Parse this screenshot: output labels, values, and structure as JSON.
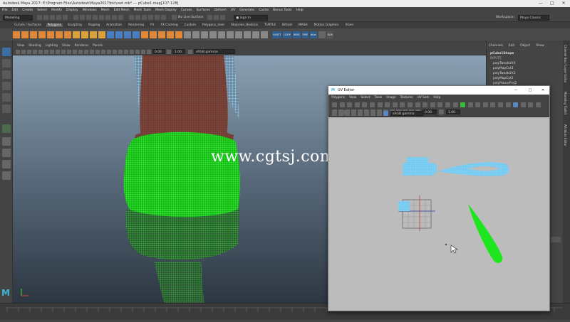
{
  "window": {
    "title": "Autodesk Maya 2017: E:\\Program Files\\Autodesk\\Maya2017\\bin\\vwt.mb* --- pCube1.map[107:128]",
    "controls": [
      "—",
      "□",
      "✕"
    ]
  },
  "menubar": {
    "items": [
      "File",
      "Edit",
      "Create",
      "Select",
      "Modify",
      "Display",
      "Windows",
      "Mesh",
      "Edit Mesh",
      "Mesh Tools",
      "Mesh Display",
      "Curves",
      "Surfaces",
      "Deform",
      "UV",
      "Generate",
      "Cache",
      "Bonus Tools",
      "Help"
    ]
  },
  "statusline": {
    "mode": "Modeling",
    "live_surface": "No Live Surface",
    "sign_in": "Sign In",
    "workspace_label": "Workspace :",
    "workspace_value": "Maya Classic"
  },
  "shelf": {
    "tabs": [
      "Curves / Surfaces",
      "Polygons",
      "Sculpting",
      "Rigging",
      "Animation",
      "Rendering",
      "FX",
      "FX Caching",
      "Custom",
      "Polygons_User",
      "Shannon_Hoskins",
      "TURTLE",
      "Bifrost",
      "MASH",
      "Motion Graphics",
      "XGen"
    ],
    "active_tab": "Polygons",
    "labels": [
      "UVSFT",
      "LOOP",
      "RING",
      "PIPE",
      "blue",
      "SLM"
    ]
  },
  "viewport": {
    "menu": [
      "View",
      "Shading",
      "Lighting",
      "Show",
      "Renderer",
      "Panels"
    ],
    "field_a": "0.00",
    "field_b": "1.00",
    "color_space": "sRGB gamma",
    "watermark": "www.cgtsj.com",
    "logo": "M"
  },
  "channelbox": {
    "tabs": [
      "Channels",
      "Edit",
      "Object",
      "Show"
    ],
    "object": "pCube1Shape",
    "inputs_label": "INPUTS",
    "inputs": [
      "polyTweakUV4",
      "polyMapCut3",
      "polyTweakUV3",
      "polyMapCut2",
      "polyPlanarProj2"
    ],
    "side_tabs": [
      "Channel Box / Layer Editor",
      "Modeling Toolkit",
      "Attribute Editor"
    ]
  },
  "uv_editor": {
    "title": "UV Editor",
    "controls": [
      "—",
      "□",
      "✕"
    ],
    "menu": [
      "Polygons",
      "View",
      "Select",
      "Tools",
      "Image",
      "Textures",
      "UV Sets",
      "Help"
    ],
    "field_a": "0.00",
    "field_b": "1.00",
    "color_space": "sRGB gamma"
  },
  "colors": {
    "wire_green": "#22ee22",
    "wire_red": "#8a3a2a",
    "wire_cyan": "#8fd9ff",
    "uv_shell": "#7fd0f5",
    "uv_green": "#1ee61e"
  }
}
